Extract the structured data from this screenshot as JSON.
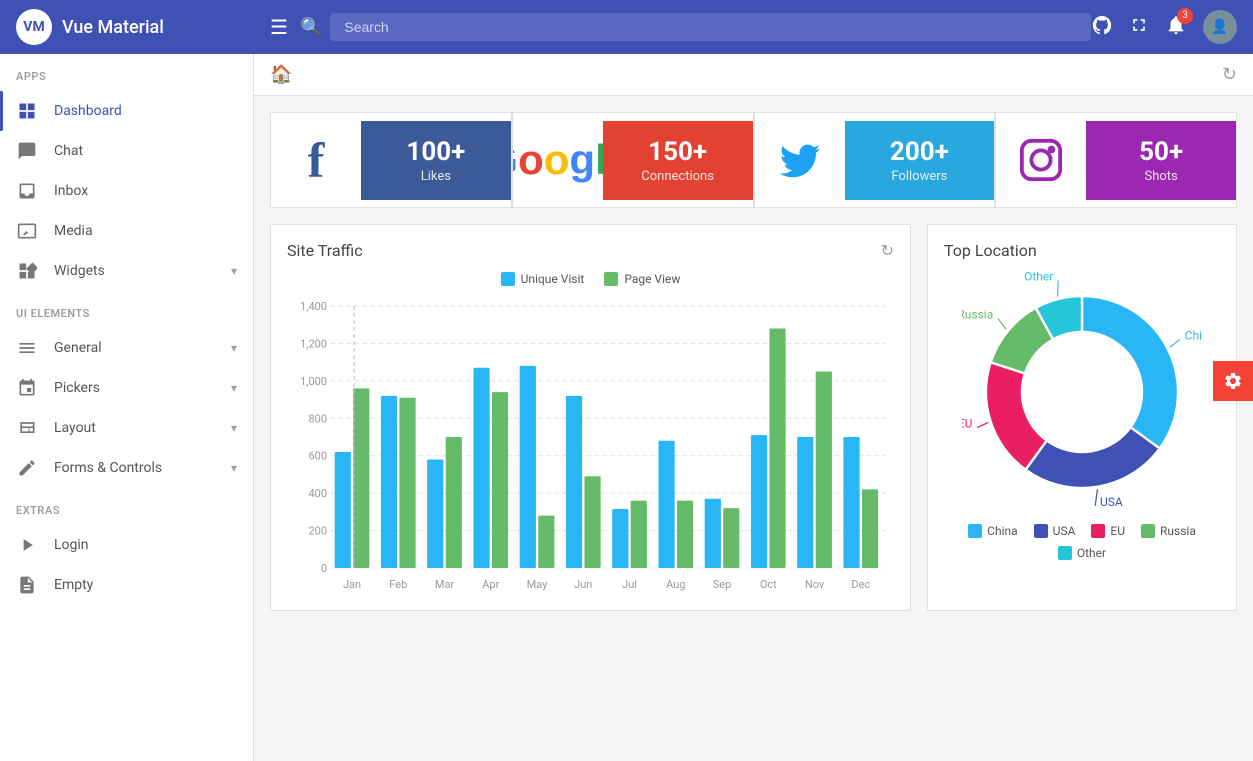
{
  "header": {
    "logo_initials": "VM",
    "title": "Vue Material",
    "search_placeholder": "Search",
    "notification_count": "3"
  },
  "sidebar": {
    "sections": [
      {
        "label": "Apps",
        "items": [
          {
            "id": "dashboard",
            "label": "Dashboard",
            "icon": "grid",
            "active": true,
            "has_chevron": false
          },
          {
            "id": "chat",
            "label": "Chat",
            "icon": "chat",
            "active": false,
            "has_chevron": false
          },
          {
            "id": "inbox",
            "label": "Inbox",
            "icon": "inbox",
            "active": false,
            "has_chevron": false
          },
          {
            "id": "media",
            "label": "Media",
            "icon": "media",
            "active": false,
            "has_chevron": false
          },
          {
            "id": "widgets",
            "label": "Widgets",
            "icon": "widgets",
            "active": false,
            "has_chevron": true
          }
        ]
      },
      {
        "label": "UI Elements",
        "items": [
          {
            "id": "general",
            "label": "General",
            "icon": "general",
            "active": false,
            "has_chevron": true
          },
          {
            "id": "pickers",
            "label": "Pickers",
            "icon": "pickers",
            "active": false,
            "has_chevron": true
          },
          {
            "id": "layout",
            "label": "Layout",
            "icon": "layout",
            "active": false,
            "has_chevron": true
          },
          {
            "id": "forms-controls",
            "label": "Forms & Controls",
            "icon": "forms",
            "active": false,
            "has_chevron": true
          }
        ]
      },
      {
        "label": "Extras",
        "items": [
          {
            "id": "login",
            "label": "Login",
            "icon": "login",
            "active": false,
            "has_chevron": false
          },
          {
            "id": "empty",
            "label": "Empty",
            "icon": "empty",
            "active": false,
            "has_chevron": false
          }
        ]
      }
    ]
  },
  "social_cards": [
    {
      "id": "facebook",
      "icon": "f",
      "icon_color": "#3b5998",
      "stat": "100+",
      "label": "Likes",
      "bg": "#3d5a98"
    },
    {
      "id": "google",
      "icon": "G",
      "icon_color": "#e34132",
      "stat": "150+",
      "label": "Connections",
      "bg": "#e34132"
    },
    {
      "id": "twitter",
      "icon": "🐦",
      "icon_color": "#29a8e0",
      "stat": "200+",
      "label": "Followers",
      "bg": "#29a8e0"
    },
    {
      "id": "instagram",
      "icon": "📷",
      "icon_color": "#9c27b0",
      "stat": "50+",
      "label": "Shots",
      "bg": "#9c27b0"
    }
  ],
  "site_traffic": {
    "title": "Site Traffic",
    "legend": [
      {
        "label": "Unique Visit",
        "color": "#29b6f6"
      },
      {
        "label": "Page View",
        "color": "#66bb6a"
      }
    ],
    "y_labels": [
      "0",
      "200",
      "400",
      "600",
      "800",
      "1,000",
      "1,200",
      "1,400"
    ],
    "months": [
      "Jan",
      "Feb",
      "Mar",
      "Apr",
      "May",
      "Jun",
      "Jul",
      "Aug",
      "Sep",
      "Oct",
      "Nov",
      "Dec"
    ],
    "unique_visit": [
      620,
      920,
      580,
      1070,
      1080,
      920,
      315,
      680,
      370,
      710,
      700,
      700
    ],
    "page_view": [
      960,
      910,
      700,
      940,
      280,
      490,
      360,
      360,
      320,
      1280,
      1050,
      420
    ]
  },
  "top_location": {
    "title": "Top Location",
    "segments": [
      {
        "label": "China",
        "value": 35,
        "color": "#29b6f6"
      },
      {
        "label": "USA",
        "value": 25,
        "color": "#3f51b5"
      },
      {
        "label": "EU",
        "value": 20,
        "color": "#e91e63"
      },
      {
        "label": "Russia",
        "value": 12,
        "color": "#66bb6a"
      },
      {
        "label": "Other",
        "value": 8,
        "color": "#26c6da"
      }
    ]
  },
  "settings_fab_label": "⚙"
}
